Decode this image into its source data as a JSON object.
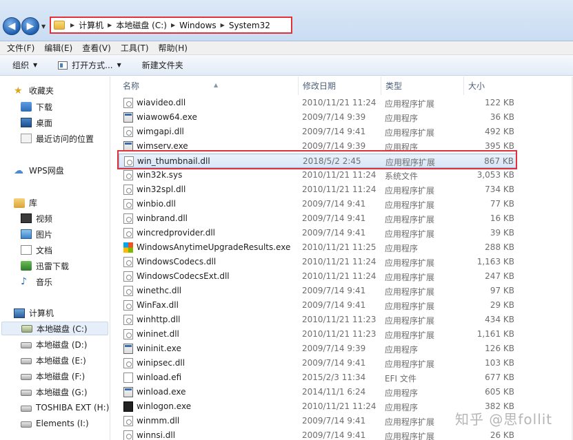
{
  "address": {
    "crumbs": [
      "计算机",
      "本地磁盘 (C:)",
      "Windows",
      "System32"
    ]
  },
  "menubar": [
    "文件(F)",
    "编辑(E)",
    "查看(V)",
    "工具(T)",
    "帮助(H)"
  ],
  "toolbar": {
    "organize": "组织",
    "open_with": "打开方式...",
    "new_folder": "新建文件夹"
  },
  "sidebar": {
    "favorites": "收藏夹",
    "favorites_items": [
      "下载",
      "桌面",
      "最近访问的位置"
    ],
    "wps": "WPS网盘",
    "libraries": "库",
    "library_items": [
      "视频",
      "图片",
      "文档",
      "迅雷下载",
      "音乐"
    ],
    "computer": "计算机",
    "drives": [
      "本地磁盘 (C:)",
      "本地磁盘 (D:)",
      "本地磁盘 (E:)",
      "本地磁盘 (F:)",
      "本地磁盘 (G:)",
      "TOSHIBA EXT (H:)",
      "Elements (I:)"
    ]
  },
  "columns": {
    "name": "名称",
    "date": "修改日期",
    "type": "类型",
    "size": "大小"
  },
  "files": [
    {
      "name": "wiavideo.dll",
      "date": "2010/11/21 11:24",
      "type": "应用程序扩展",
      "size": "122 KB",
      "icon": "dll"
    },
    {
      "name": "wiawow64.exe",
      "date": "2009/7/14 9:39",
      "type": "应用程序",
      "size": "36 KB",
      "icon": "exe"
    },
    {
      "name": "wimgapi.dll",
      "date": "2009/7/14 9:41",
      "type": "应用程序扩展",
      "size": "492 KB",
      "icon": "dll"
    },
    {
      "name": "wimserv.exe",
      "date": "2009/7/14 9:39",
      "type": "应用程序",
      "size": "395 KB",
      "icon": "exe"
    },
    {
      "name": "win_thumbnail.dll",
      "date": "2018/5/2 2:45",
      "type": "应用程序扩展",
      "size": "867 KB",
      "icon": "dll"
    },
    {
      "name": "win32k.sys",
      "date": "2010/11/21 11:24",
      "type": "系统文件",
      "size": "3,053 KB",
      "icon": "dll"
    },
    {
      "name": "win32spl.dll",
      "date": "2010/11/21 11:24",
      "type": "应用程序扩展",
      "size": "734 KB",
      "icon": "dll"
    },
    {
      "name": "winbio.dll",
      "date": "2009/7/14 9:41",
      "type": "应用程序扩展",
      "size": "77 KB",
      "icon": "dll"
    },
    {
      "name": "winbrand.dll",
      "date": "2009/7/14 9:41",
      "type": "应用程序扩展",
      "size": "16 KB",
      "icon": "dll"
    },
    {
      "name": "wincredprovider.dll",
      "date": "2009/7/14 9:41",
      "type": "应用程序扩展",
      "size": "39 KB",
      "icon": "dll"
    },
    {
      "name": "WindowsAnytimeUpgradeResults.exe",
      "date": "2010/11/21 11:25",
      "type": "应用程序",
      "size": "288 KB",
      "icon": "win"
    },
    {
      "name": "WindowsCodecs.dll",
      "date": "2010/11/21 11:24",
      "type": "应用程序扩展",
      "size": "1,163 KB",
      "icon": "dll"
    },
    {
      "name": "WindowsCodecsExt.dll",
      "date": "2010/11/21 11:24",
      "type": "应用程序扩展",
      "size": "247 KB",
      "icon": "dll"
    },
    {
      "name": "winethc.dll",
      "date": "2009/7/14 9:41",
      "type": "应用程序扩展",
      "size": "97 KB",
      "icon": "dll"
    },
    {
      "name": "WinFax.dll",
      "date": "2009/7/14 9:41",
      "type": "应用程序扩展",
      "size": "29 KB",
      "icon": "dll"
    },
    {
      "name": "winhttp.dll",
      "date": "2010/11/21 11:23",
      "type": "应用程序扩展",
      "size": "434 KB",
      "icon": "dll"
    },
    {
      "name": "wininet.dll",
      "date": "2010/11/21 11:23",
      "type": "应用程序扩展",
      "size": "1,161 KB",
      "icon": "dll"
    },
    {
      "name": "wininit.exe",
      "date": "2009/7/14 9:39",
      "type": "应用程序",
      "size": "126 KB",
      "icon": "exe"
    },
    {
      "name": "winipsec.dll",
      "date": "2009/7/14 9:41",
      "type": "应用程序扩展",
      "size": "103 KB",
      "icon": "dll"
    },
    {
      "name": "winload.efi",
      "date": "2015/2/3 11:34",
      "type": "EFI 文件",
      "size": "677 KB",
      "icon": "blank"
    },
    {
      "name": "winload.exe",
      "date": "2014/11/1 6:24",
      "type": "应用程序",
      "size": "605 KB",
      "icon": "exe"
    },
    {
      "name": "winlogon.exe",
      "date": "2010/11/21 11:24",
      "type": "应用程序",
      "size": "382 KB",
      "icon": "logon"
    },
    {
      "name": "winmm.dll",
      "date": "2009/7/14 9:41",
      "type": "应用程序扩展",
      "size": "",
      "icon": "dll"
    },
    {
      "name": "winnsi.dll",
      "date": "2009/7/14 9:41",
      "type": "应用程序扩展",
      "size": "26 KB",
      "icon": "dll"
    }
  ],
  "watermark": "知乎 @思follit",
  "colors": {
    "highlight_border": "#e0313a",
    "link_blue": "#1f5fb0"
  }
}
